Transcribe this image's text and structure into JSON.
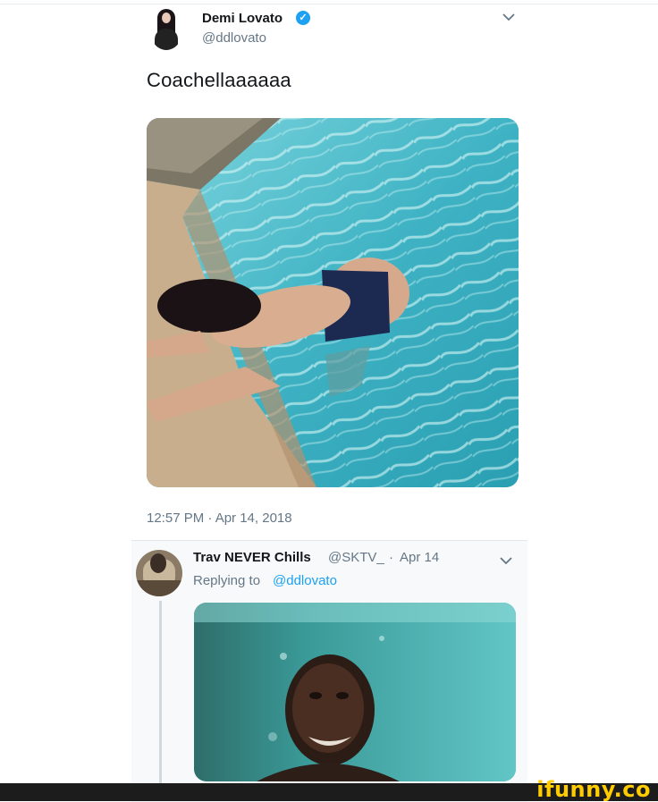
{
  "tweet": {
    "author_name": "Demi Lovato",
    "verified_icon": "verified-badge-icon",
    "verified_glyph": "✓",
    "handle": "@ddlovato",
    "text": "Coachellaaaaaa",
    "timestamp": "12:57 PM · Apr 14, 2018",
    "menu_icon": "chevron-down-icon"
  },
  "reply": {
    "author_name": "Trav NEVER Chills",
    "handle": "@SKTV_",
    "separator": "·",
    "date": "Apr 14",
    "replying_to_label": "Replying to",
    "replying_to_handle": "@ddlovato",
    "menu_icon": "chevron-down-icon"
  },
  "footer": {
    "watermark": "ifunny.co"
  },
  "colors": {
    "link": "#1da1f2",
    "secondary_text": "#657786",
    "primary_text": "#14171a",
    "watermark": "#ffcc00"
  }
}
